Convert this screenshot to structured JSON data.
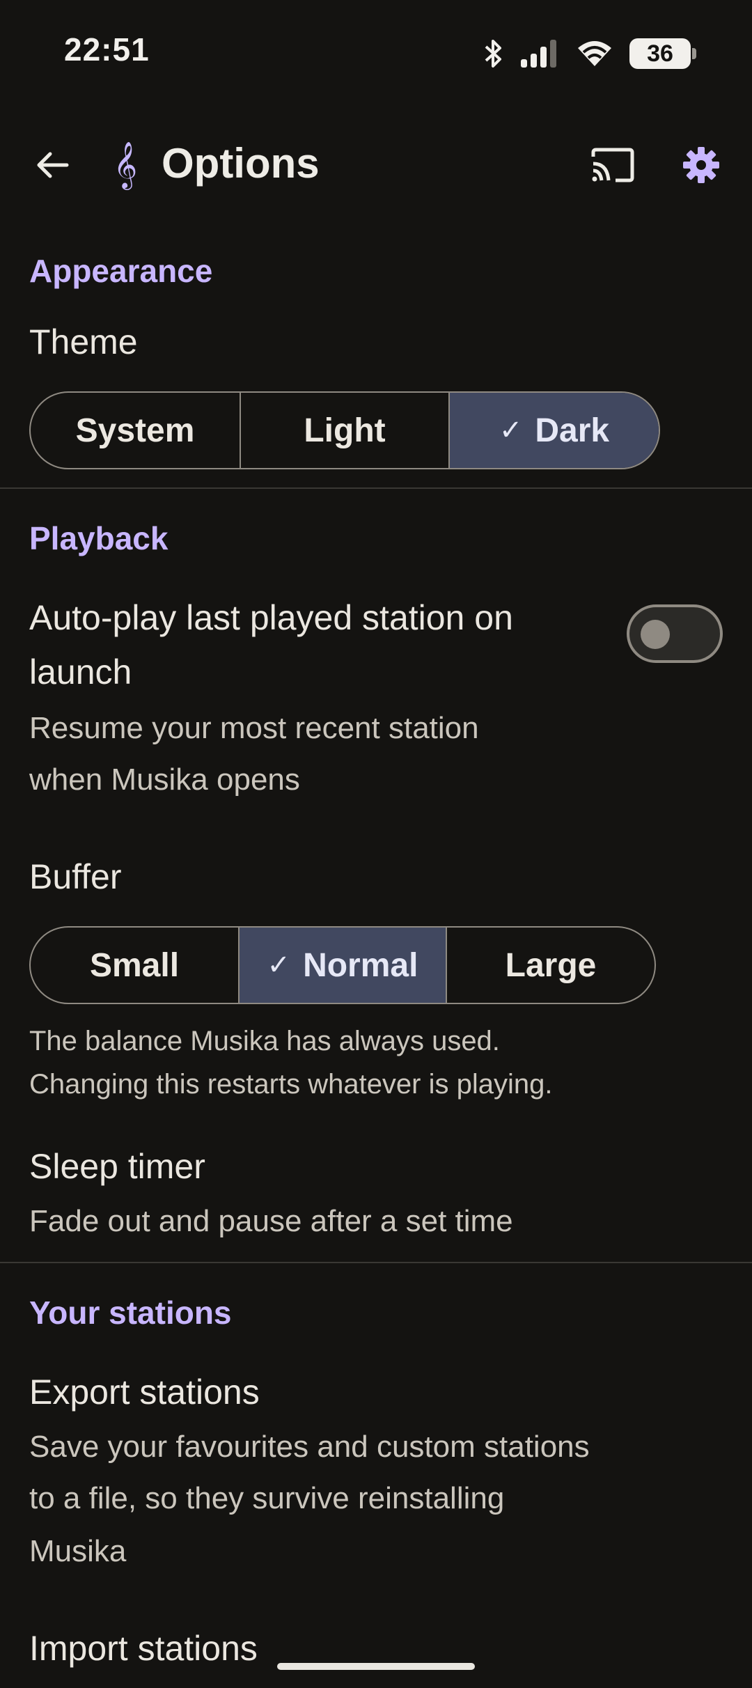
{
  "status_bar": {
    "time": "22:51",
    "battery": "36",
    "icons": [
      "bluetooth-icon",
      "signal-icon",
      "wifi-icon",
      "battery-icon"
    ]
  },
  "app_bar": {
    "title": "Options",
    "icons": [
      "back-arrow-icon",
      "treble-clef-icon",
      "cast-icon",
      "gear-icon"
    ]
  },
  "appearance": {
    "header": "Appearance",
    "theme_label": "Theme",
    "theme_options": [
      "System",
      "Light",
      "Dark"
    ],
    "theme_selected": "Dark"
  },
  "playback": {
    "header": "Playback",
    "autoplay_title_line1": "Auto-play last played station on",
    "autoplay_title_line2": "launch",
    "autoplay_desc_line1": "Resume your most recent station",
    "autoplay_desc_line2": "when Musika opens",
    "autoplay_enabled": false,
    "buffer_label": "Buffer",
    "buffer_options": [
      "Small",
      "Normal",
      "Large"
    ],
    "buffer_selected": "Normal",
    "buffer_desc_line1": "The balance Musika has always used.",
    "buffer_desc_line2": "Changing this restarts whatever is playing.",
    "sleep_title": "Sleep timer",
    "sleep_desc": "Fade out and pause after a set time"
  },
  "stations": {
    "header": "Your stations",
    "export_title": "Export stations",
    "export_desc_line1": "Save your favourites and custom stations",
    "export_desc_line2": "to a file, so they survive reinstalling",
    "export_desc_line3": "Musika",
    "import_title": "Import stations"
  },
  "colors": {
    "background": "#141311",
    "accent": "#c8b6ff",
    "selected_segment": "#414860"
  }
}
